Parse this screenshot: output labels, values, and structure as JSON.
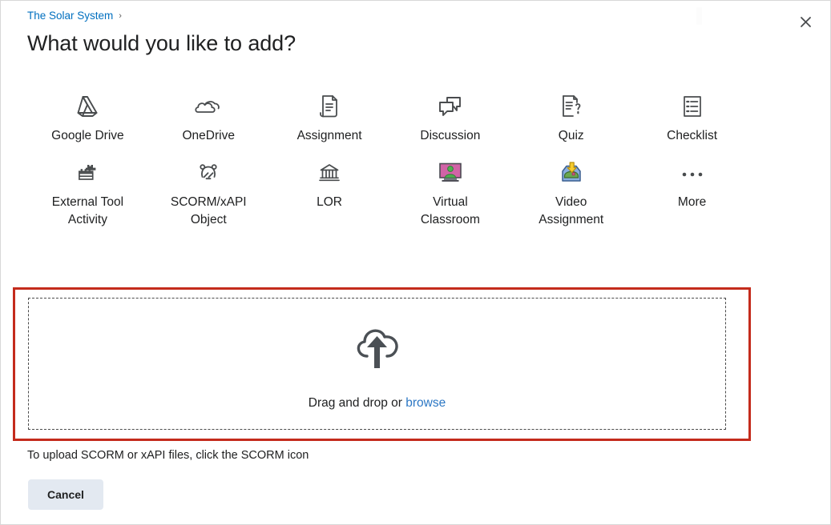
{
  "header": {
    "breadcrumb": "The Solar System",
    "breadcrumb_separator": "›",
    "title": "What would you like to add?",
    "close_label": "✕"
  },
  "tiles_row1": [
    {
      "label": "Google Drive",
      "icon": "google-drive-icon"
    },
    {
      "label": "OneDrive",
      "icon": "onedrive-icon"
    },
    {
      "label": "Assignment",
      "icon": "assignment-document-icon"
    },
    {
      "label": "Discussion",
      "icon": "discussion-bubbles-icon"
    },
    {
      "label": "Quiz",
      "icon": "quiz-question-icon"
    },
    {
      "label": "Checklist",
      "icon": "checklist-icon"
    }
  ],
  "tiles_row2": [
    {
      "label": "External Tool Activity",
      "icon": "external-tool-brick-icon"
    },
    {
      "label": "SCORM/xAPI Object",
      "icon": "scorm-xapi-icon"
    },
    {
      "label": "LOR",
      "icon": "lor-building-icon"
    },
    {
      "label": "Virtual Classroom",
      "icon": "virtual-classroom-monitor-icon"
    },
    {
      "label": "Video Assignment",
      "icon": "video-assignment-inbox-icon"
    },
    {
      "label": "More",
      "icon": "more-ellipsis-icon"
    }
  ],
  "dropzone": {
    "text_prefix": "Drag and drop or",
    "browse_label": "browse",
    "icon": "cloud-upload-icon"
  },
  "footer": {
    "hint": "To upload SCORM or xAPI files, click the SCORM icon",
    "cancel_label": "Cancel"
  },
  "colors": {
    "link": "#006fbf",
    "browse_link": "#2c77c4",
    "highlight_border": "#c42b1c",
    "icon_dark": "#494c4e",
    "cancel_bg": "#e3e9f1",
    "virtual_classroom_screen": "#d163a6",
    "virtual_classroom_person": "#4fb14f",
    "video_assignment_tray": "#88aee0",
    "video_assignment_arrow": "#f5cb2e"
  }
}
